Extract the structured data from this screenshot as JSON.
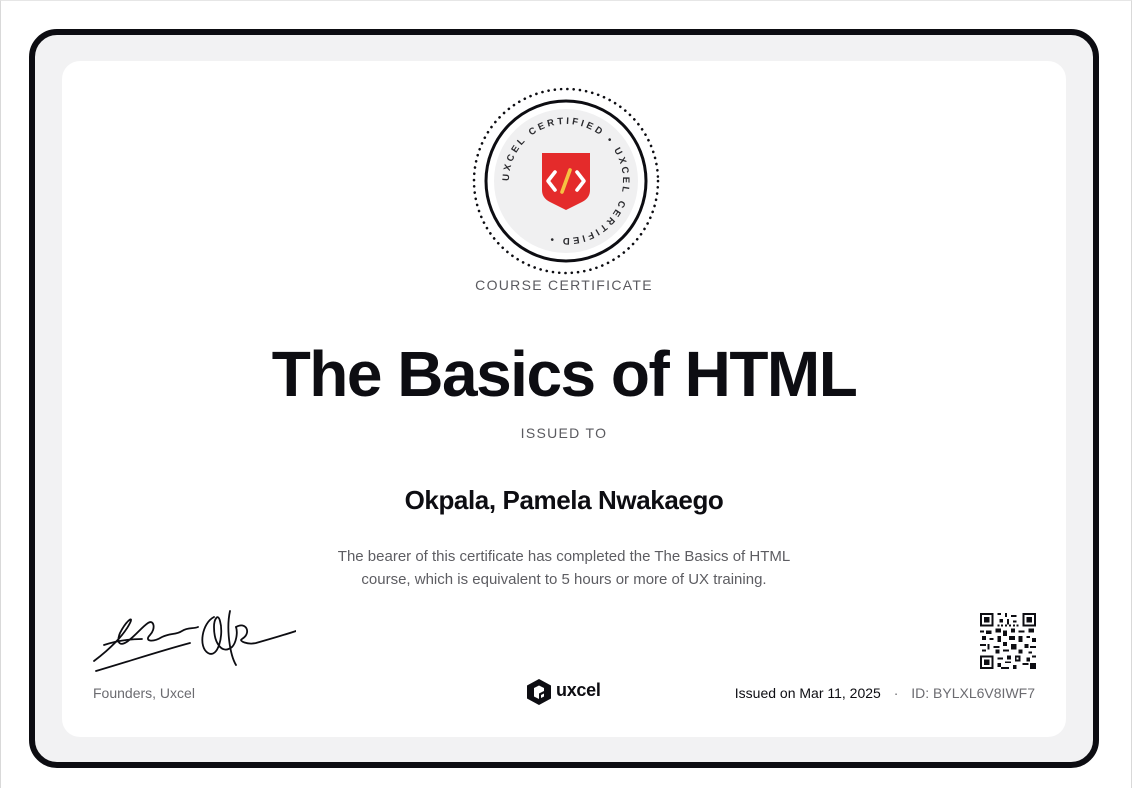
{
  "badge": {
    "ring_text": "UXCEL CERTIFIED • UXCEL CERTIFIED •",
    "icon": "html-code-shield-icon",
    "colors": {
      "shield": "#e42b2b",
      "ring": "#0d0d12",
      "inner": "#f0f0f1"
    }
  },
  "certificate": {
    "type_label": "COURSE CERTIFICATE",
    "title": "The Basics of HTML",
    "issued_to_label": "ISSUED TO",
    "recipient": "Okpala, Pamela Nwakaego",
    "description": "The bearer of this certificate has completed the The Basics of HTML course, which is equivalent to 5 hours or more of UX training."
  },
  "footer": {
    "founders_label": "Founders, Uxcel",
    "brand": "uxcel",
    "issued_on": "Issued on Mar 11, 2025",
    "separator": "·",
    "cert_id": "ID: BYLXL6V8IWF7"
  },
  "colors": {
    "text": "#0d0d12",
    "muted": "#6b6b70",
    "frame": "#0d0d12",
    "frame_bg": "#f2f2f3"
  }
}
